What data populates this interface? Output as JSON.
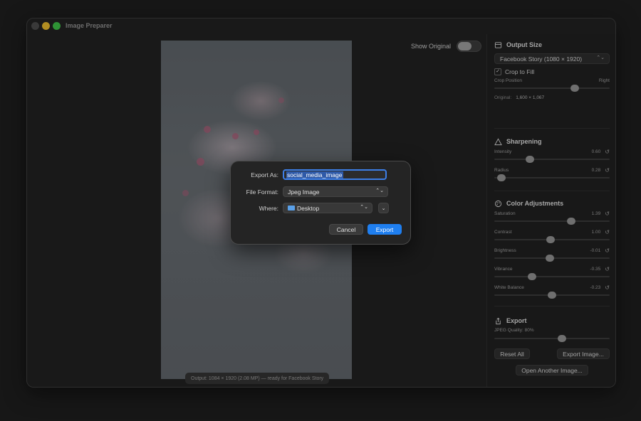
{
  "window": {
    "title": "Image Preparer"
  },
  "canvas": {
    "show_original_label": "Show Original",
    "show_original_on": false,
    "status": "Output: 1084 × 1920 (2.08 MP) — ready for Facebook Story"
  },
  "sidebar": {
    "output_size": {
      "heading": "Output Size",
      "preset": "Facebook Story (1080 × 1920)",
      "crop_to_fill_label": "Crop to Fill",
      "crop_to_fill_checked": true,
      "crop_position_label": "Crop Position",
      "crop_position_right_label": "Right",
      "crop_position_value": 0.7,
      "original_label": "Original:",
      "original_value": "1,600 × 1,067"
    },
    "sharpening": {
      "heading": "Sharpening",
      "intensity_label": "Intensity",
      "intensity_value": "0.60",
      "radius_label": "Radius",
      "radius_value": "0.28"
    },
    "color": {
      "heading": "Color Adjustments",
      "saturation_label": "Saturation",
      "saturation_value": "1.39",
      "contrast_label": "Contrast",
      "contrast_value": "1.00",
      "brightness_label": "Brightness",
      "brightness_value": "-0.01",
      "vibrance_label": "Vibrance",
      "vibrance_value": "-0.35",
      "white_balance_label": "White Balance",
      "white_balance_value": "-0.23"
    },
    "export": {
      "heading": "Export",
      "jpeg_quality_label": "JPEG Quality: 80%",
      "jpeg_quality_value": 0.8,
      "reset_all": "Reset All",
      "export_image": "Export Image...",
      "open_another": "Open Another Image..."
    }
  },
  "dialog": {
    "export_as_label": "Export As:",
    "export_as_value": "social_media_image",
    "file_format_label": "File Format:",
    "file_format_value": "Jpeg Image",
    "where_label": "Where:",
    "where_value": "Desktop",
    "cancel": "Cancel",
    "export": "Export"
  },
  "icons": {
    "crop": "crop-icon",
    "sharpen": "triangle-icon",
    "color": "palette-icon",
    "export": "share-icon",
    "reset": "reset-icon",
    "folder": "folder-icon"
  },
  "colors": {
    "accent": "#1f7ff0",
    "focus": "#3d7ee6"
  }
}
